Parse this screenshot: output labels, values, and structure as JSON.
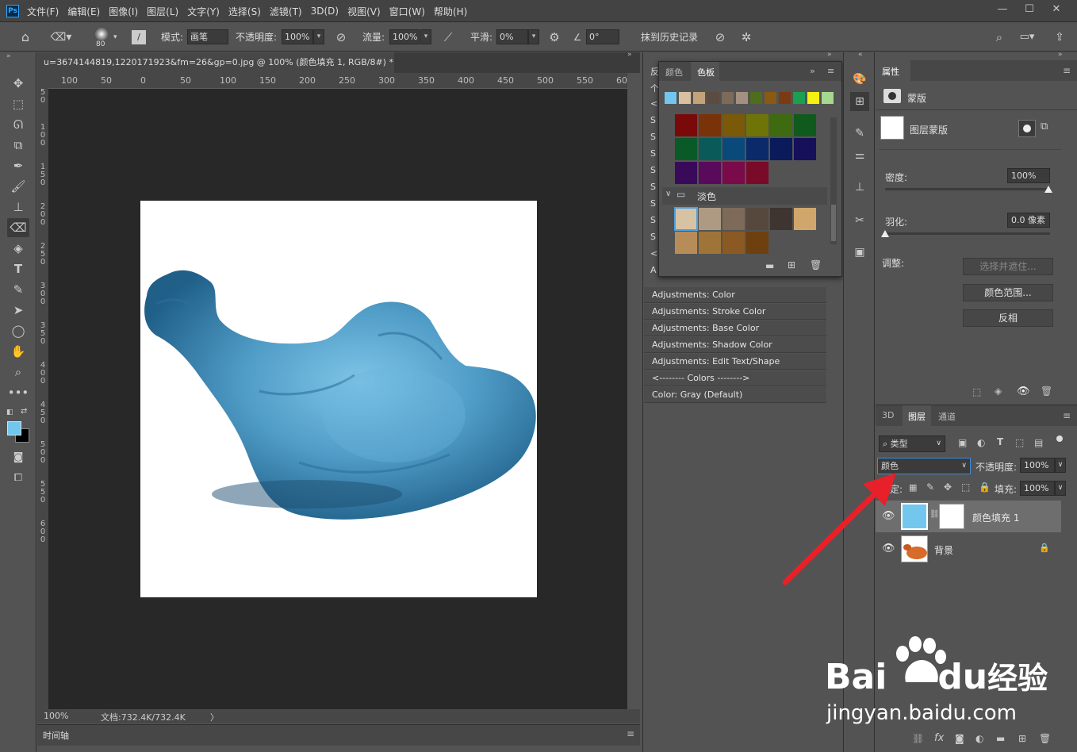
{
  "menubar": {
    "logo": "Ps",
    "items": [
      "文件(F)",
      "编辑(E)",
      "图像(I)",
      "图层(L)",
      "文字(Y)",
      "选择(S)",
      "滤镜(T)",
      "3D(D)",
      "视图(V)",
      "窗口(W)",
      "帮助(H)"
    ],
    "min": "—",
    "max": "☐",
    "close": "✕"
  },
  "options": {
    "brush_size": "80",
    "mode_label": "模式:",
    "mode_value": "画笔",
    "opacity_label": "不透明度:",
    "opacity_value": "100%",
    "flow_label": "流量:",
    "flow_value": "100%",
    "smooth_label": "平滑:",
    "smooth_value": "0%",
    "angle_value": "0°",
    "erase_history": "抹到历史记录"
  },
  "document": {
    "tab_title": "u=3674144819,1220171923&fm=26&gp=0.jpg @ 100% (颜色填充 1, RGB/8#) *",
    "close": "×"
  },
  "ruler_top": [
    "100",
    "50",
    "0",
    "50",
    "100",
    "150",
    "200",
    "250",
    "300",
    "350",
    "400",
    "450",
    "500",
    "550",
    "60"
  ],
  "ruler_left": [
    "5\n0",
    "1\n0\n0",
    "1\n5\n0",
    "2\n0\n0",
    "2\n5\n0",
    "3\n0\n0",
    "3\n5\n0",
    "4\n0\n0",
    "4\n5\n0",
    "5\n0\n0",
    "5\n5\n0",
    "6\n0\n0"
  ],
  "status": {
    "zoom": "100%",
    "doc_info": "文档:732.4K/732.4K",
    "arrow": "〉"
  },
  "timeline": {
    "label": "时间轴"
  },
  "swatches": {
    "tab_color": "颜色",
    "tab_swatches": "色板",
    "folder_name": "淡色",
    "recent": [
      "#73c7ee",
      "#d8c0a0",
      "#c4a27a",
      "#5b4c42",
      "#7d6a58",
      "#a39080",
      "#4d6e1a",
      "#8a5a12",
      "#7a3a12",
      "#1aa050",
      "#f4f010",
      "#a6d890"
    ],
    "row1": [
      "#7a0a0a",
      "#7a3208",
      "#7a5a08",
      "#6e7408",
      "#3e6a10",
      "#105a1e"
    ],
    "row2": [
      "#0a5a28",
      "#0a5a5a",
      "#0a4a7a",
      "#0a2a6a",
      "#0a1a5a",
      "#16105a"
    ],
    "row3": [
      "#3a0a5a",
      "#5a0a5a",
      "#7a0a4a",
      "#7a0a2a"
    ],
    "pale1": [
      "#d8c2a4",
      "#ae9a82",
      "#7d6a58",
      "#57483e",
      "#3e3430",
      "#d0a66c"
    ],
    "pale2": [
      "#b88c58",
      "#9e7438",
      "#8a5a22",
      "#6e4010"
    ]
  },
  "history": {
    "col_markers": [
      "反",
      "个",
      "<",
      "S",
      "S",
      "S",
      "S",
      "S",
      "S",
      "S",
      "S",
      "<",
      "A"
    ],
    "rows": [
      "Adjustments: Color",
      "Adjustments: Stroke Color",
      "Adjustments: Base Color",
      "Adjustments: Shadow Color",
      "Adjustments: Edit Text/Shape",
      "<-------- Colors -------->",
      "Color: Gray (Default)"
    ]
  },
  "properties": {
    "tab": "属性",
    "mask_label": "蒙版",
    "layer_mask": "图层蒙版",
    "density_label": "密度:",
    "density_value": "100%",
    "feather_label": "羽化:",
    "feather_value": "0.0 像素",
    "adjust_label": "调整:",
    "select_mask": "选择并遮住...",
    "color_range": "颜色范围...",
    "invert": "反相"
  },
  "layers": {
    "tab_3d": "3D",
    "tab_layers": "图层",
    "tab_channels": "通道",
    "filter_kind": "类型",
    "blend_mode": "颜色",
    "opacity_label": "不透明度:",
    "opacity_value": "100%",
    "lock_label": "锁定:",
    "fill_label": "填充:",
    "fill_value": "100%",
    "items": [
      {
        "name": "颜色填充 1",
        "selected": true
      },
      {
        "name": "背景",
        "selected": false
      }
    ]
  },
  "watermark": {
    "brand": "Bai",
    "brand2": "du",
    "brand3": "经验",
    "url": "jingyan.baidu.com"
  },
  "colors": {
    "foreground": "#73c7ee",
    "background": "#000000",
    "accent_arrow": "#e8202a",
    "fill_color": "#73c7ee"
  }
}
